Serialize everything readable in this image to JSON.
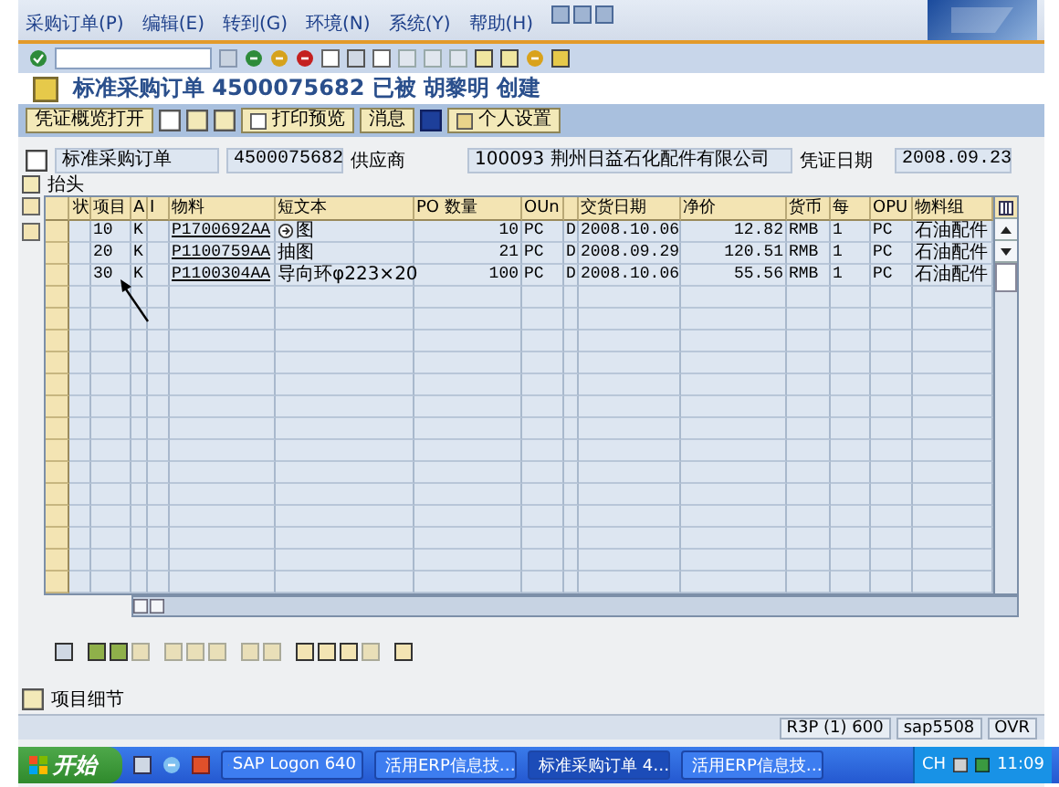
{
  "menu": [
    "采购订单(P)",
    "编辑(E)",
    "转到(G)",
    "环境(N)",
    "系统(Y)",
    "帮助(H)"
  ],
  "title": "标准采购订单 4500075682 已被 胡黎明 创建",
  "app_toolbar": {
    "overview_button": "凭证概览打开",
    "print_preview_button": "打印预览",
    "messages_button": "消息",
    "personal_settings_button": "个人设置"
  },
  "header": {
    "doc_type": "标准采购订单",
    "doc_number": "4500075682",
    "vendor_label": "供应商",
    "vendor": "100093 荆州日益石化配件有限公司",
    "date_label": "凭证日期",
    "date": "2008.09.23"
  },
  "section_label": "抬头",
  "table": {
    "columns": [
      {
        "label": "状",
        "kind": "status"
      },
      {
        "label": "项目",
        "kind": "text"
      },
      {
        "label": "A",
        "kind": "text"
      },
      {
        "label": "I",
        "kind": "text"
      },
      {
        "label": "物料",
        "kind": "link"
      },
      {
        "label": "短文本",
        "kind": "text"
      },
      {
        "label": "PO 数量",
        "kind": "number"
      },
      {
        "label": "OUn",
        "kind": "text"
      },
      {
        "kind": "text"
      },
      {
        "label": "交货日期",
        "kind": "text"
      },
      {
        "label": "净价",
        "kind": "number"
      },
      {
        "label": "货币",
        "kind": "text"
      },
      {
        "label": "每",
        "kind": "text"
      },
      {
        "label": "OPU",
        "kind": "text"
      },
      {
        "label": "物料组",
        "kind": "text"
      }
    ],
    "rows": [
      {
        "icon": true,
        "cells": [
          "",
          "10",
          "K",
          "",
          "P1700692AA",
          "图",
          "10",
          "PC",
          "D",
          "2008.10.06",
          "12.82",
          "RMB",
          "1",
          "PC",
          "石油配件"
        ]
      },
      {
        "icon": false,
        "cells": [
          "",
          "20",
          "K",
          "",
          "P1100759AA",
          "抽图",
          "21",
          "PC",
          "D",
          "2008.09.29",
          "120.51",
          "RMB",
          "1",
          "PC",
          "石油配件"
        ]
      },
      {
        "icon": false,
        "cells": [
          "",
          "30",
          "K",
          "",
          "P1100304AA",
          "导向环φ223×20",
          "100",
          "PC",
          "D",
          "2008.10.06",
          "55.56",
          "RMB",
          "1",
          "PC",
          "石油配件"
        ]
      }
    ]
  },
  "item_detail_label": "项目细节",
  "status_bar": {
    "system": "R3P (1) 600",
    "server": "sap5508",
    "mode": "OVR"
  },
  "taskbar": {
    "start": "开始",
    "tasks": [
      {
        "label": "SAP Logon 640",
        "selected": false
      },
      {
        "label": "活用ERP信息技…",
        "selected": false
      },
      {
        "label": "标准采购订单 4…",
        "selected": true
      },
      {
        "label": "活用ERP信息技…",
        "selected": false
      }
    ],
    "language": "CH",
    "clock": "11:09"
  }
}
